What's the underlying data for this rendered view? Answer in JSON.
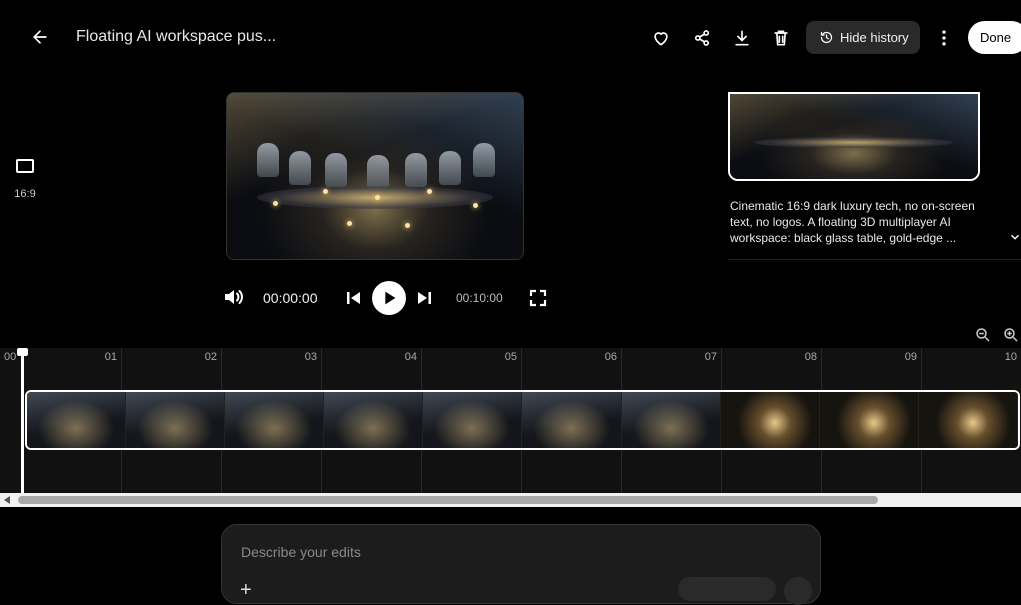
{
  "header": {
    "title": "Floating AI workspace pus...",
    "hide_history_label": "Hide history",
    "done_label": "Done",
    "icons": [
      "back-arrow-icon",
      "heart-icon",
      "share-icon",
      "download-icon",
      "trash-icon",
      "history-icon",
      "more-vert-icon"
    ]
  },
  "aspect": {
    "label": "16:9",
    "icon": "aspect-ratio-icon"
  },
  "player": {
    "current_time": "00:00:00",
    "duration": "00:10:00",
    "icons": [
      "volume-icon",
      "skip-previous-icon",
      "play-icon",
      "skip-next-icon",
      "fullscreen-icon"
    ]
  },
  "history": {
    "description": "Cinematic 16:9 dark luxury tech, no on-screen text, no logos. A floating 3D multiplayer AI workspace: black glass table, gold-edge ..."
  },
  "timeline": {
    "ticks": [
      "00",
      "01",
      "02",
      "03",
      "04",
      "05",
      "06",
      "07",
      "08",
      "09",
      "10"
    ],
    "zoom_icons": [
      "zoom-out-icon",
      "zoom-in-icon"
    ]
  },
  "prompt": {
    "placeholder": "Describe your edits",
    "plus": "+"
  },
  "colors": {
    "background": "#000000",
    "timeline_bg": "#111111",
    "accent": "#ffffff",
    "chip": "#2a2a2a"
  }
}
